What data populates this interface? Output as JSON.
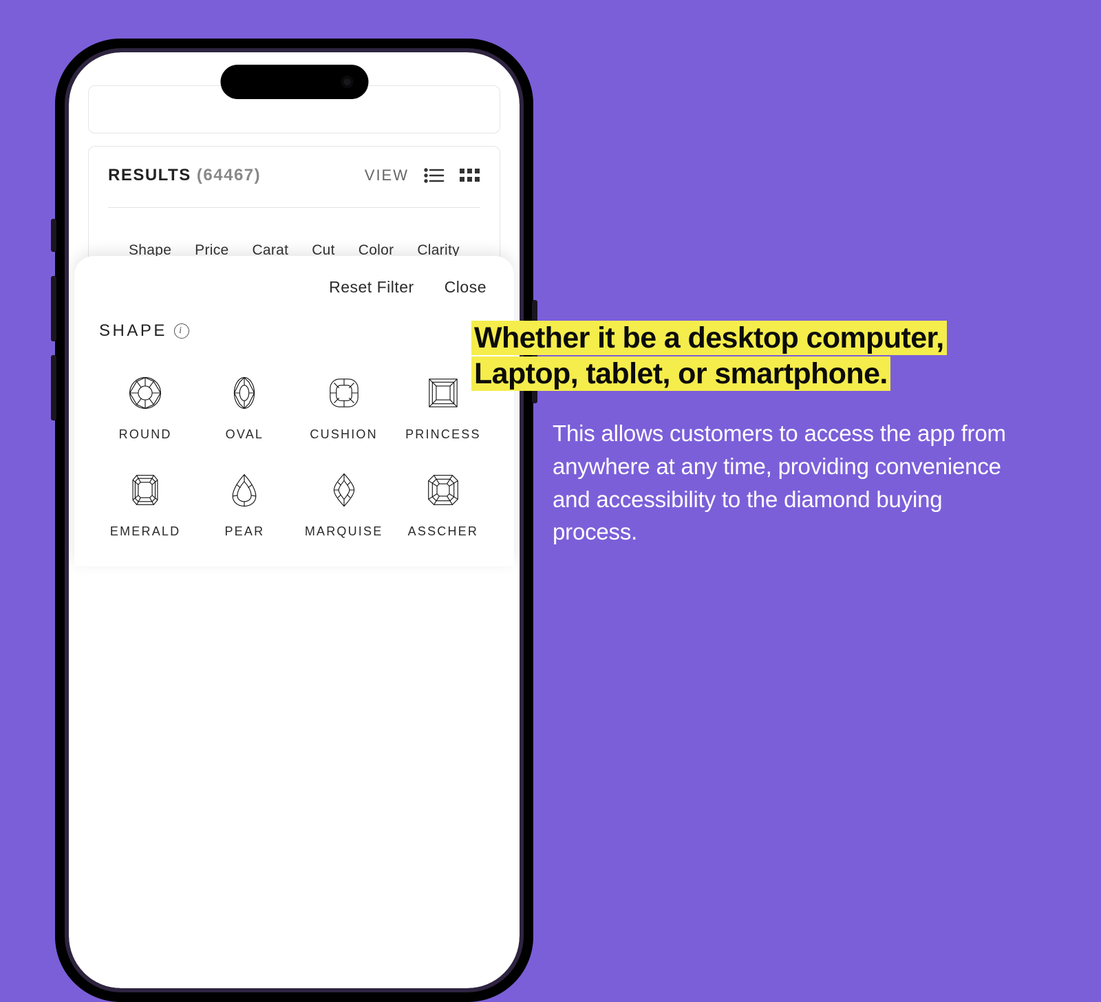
{
  "results": {
    "label": "RESULTS",
    "count": "(64467)",
    "view_label": "VIEW"
  },
  "tabs": [
    "Shape",
    "Price",
    "Carat",
    "Cut",
    "Color",
    "Clarity"
  ],
  "sheet": {
    "reset": "Reset Filter",
    "close": "Close",
    "title": "SHAPE",
    "shapes": [
      "ROUND",
      "OVAL",
      "CUSHION",
      "PRINCESS",
      "EMERALD",
      "PEAR",
      "MARQUISE",
      "ASSCHER"
    ]
  },
  "copy": {
    "headline1": "Whether it be a desktop computer,",
    "headline2": "Laptop, tablet, or smartphone.",
    "body": "This allows customers to access the app from anywhere at any time, providing convenience and accessibility to the diamond buying process."
  }
}
